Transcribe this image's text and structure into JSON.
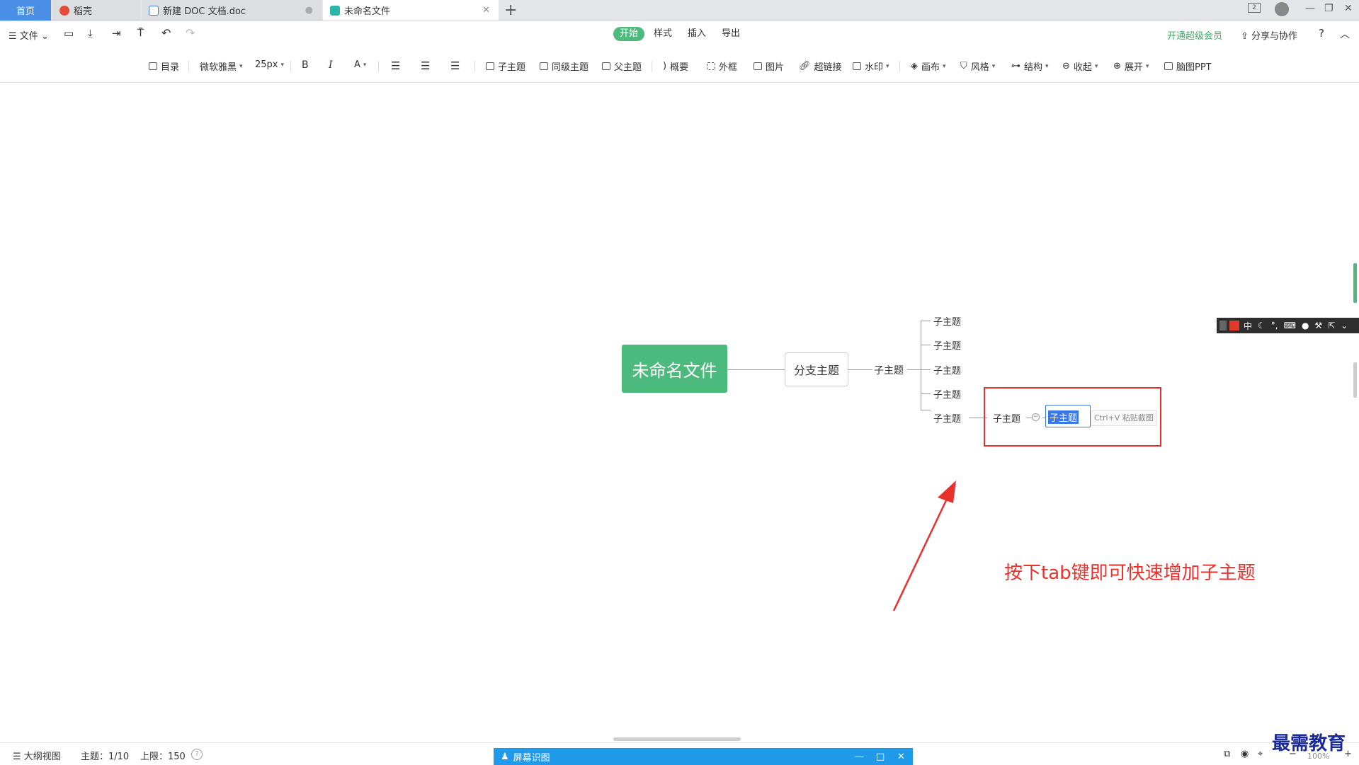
{
  "tabs": {
    "home": "首页",
    "daoke": "稻壳",
    "doc": "新建 DOC 文档.doc",
    "mind": "未命名文件"
  },
  "menu": {
    "file": "文件",
    "ribbon_tabs": [
      "开始",
      "样式",
      "插入",
      "导出"
    ],
    "vip": "开通超级会员",
    "share": "分享与协作",
    "help": "?"
  },
  "toolbar": {
    "outline": "目录",
    "font": "微软雅黑",
    "size": "25px",
    "bold": "B",
    "italic": "I",
    "color": "A",
    "child": "子主题",
    "sibling": "同级主题",
    "parent": "父主题",
    "summary": "概要",
    "frame": "外框",
    "image": "图片",
    "link": "超链接",
    "watermark": "水印",
    "canvas": "画布",
    "style": "风格",
    "structure": "结构",
    "collapse": "收起",
    "expand": "展开",
    "ppt": "脑图PPT"
  },
  "mindmap": {
    "root": "未命名文件",
    "branch": "分支主题",
    "level2": "子主题",
    "level3": [
      "子主题",
      "子主题",
      "子主题",
      "子主题",
      "子主题"
    ],
    "level4": "子主题",
    "editing": "子主题",
    "paste_hint": "Ctrl+V 粘贴截图"
  },
  "annotation": {
    "text": "按下tab键即可快速增加子主题"
  },
  "ime": {
    "lang": "中"
  },
  "status": {
    "outline_view": "大纲视图",
    "topics": "主题：1/10",
    "limit": "上限：150",
    "zoom": "100%"
  },
  "screen_recognize": {
    "title": "屏幕识图"
  },
  "watermark": {
    "text": "最需教育"
  },
  "colors": {
    "accent_green": "#4cba7d",
    "tab_blue": "#4a8ee8",
    "annotation_red": "#e8302c",
    "selection_blue": "#3b78e7"
  }
}
